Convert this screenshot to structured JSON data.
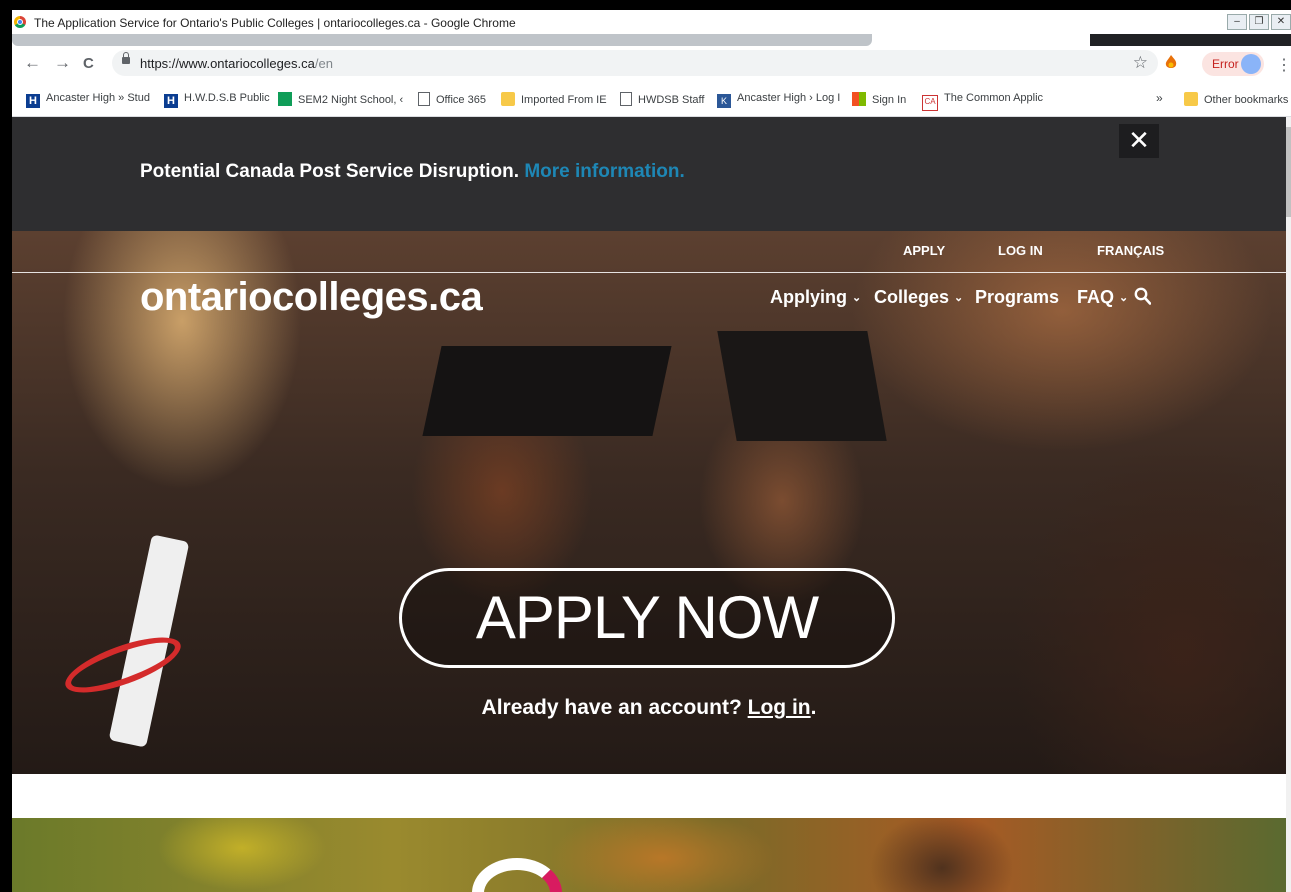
{
  "window": {
    "title": "The Application Service for Ontario's Public Colleges | ontariocolleges.ca - Google Chrome",
    "controls": [
      "–",
      "❐",
      "✕"
    ]
  },
  "toolbar": {
    "back": "←",
    "forward": "→",
    "reload": "C",
    "url_host": "https://www.ontariocolleges.ca",
    "url_path": "/en",
    "star": "☆",
    "error_label": "Error",
    "menu": "⋮"
  },
  "bookmarks": {
    "items": [
      {
        "label": "Ancaster High » Stud",
        "icon": "H"
      },
      {
        "label": "H.W.D.S.B Public",
        "icon": "H"
      },
      {
        "label": "SEM2 Night School, ‹",
        "icon": ""
      },
      {
        "label": "Office 365",
        "icon": ""
      },
      {
        "label": "Imported From IE",
        "icon": ""
      },
      {
        "label": "HWDSB Staff",
        "icon": ""
      },
      {
        "label": "Ancaster High › Log I",
        "icon": "K"
      },
      {
        "label": "Sign In",
        "icon": ""
      },
      {
        "label": "The Common Applic",
        "icon": "CA"
      }
    ],
    "more": "»",
    "other": "Other bookmarks"
  },
  "alert": {
    "text": "Potential Canada Post Service Disruption.",
    "link": "More information.",
    "close": "✕"
  },
  "site": {
    "top_links": [
      "APPLY",
      "LOG IN",
      "FRANÇAIS"
    ],
    "logo": "ontariocolleges.ca",
    "nav": [
      {
        "label": "Applying",
        "has_menu": true
      },
      {
        "label": "Colleges",
        "has_menu": true
      },
      {
        "label": "Programs",
        "has_menu": false
      },
      {
        "label": "FAQ",
        "has_menu": true
      }
    ],
    "cta": "APPLY NOW",
    "account_text": "Already have an account?",
    "login_link": "Log in",
    "account_end": "."
  },
  "icons": {
    "chevron": "⌄",
    "search": "search-icon"
  }
}
